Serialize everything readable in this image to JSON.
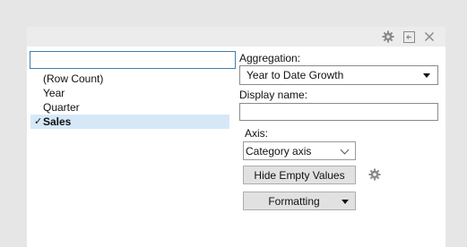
{
  "colors": {
    "selection": "#d6e8f8",
    "search_border": "#3c7fb1",
    "icon": "#8a8a8a"
  },
  "titlebar": {
    "icons": [
      "gear-icon",
      "dock-icon",
      "close-icon"
    ]
  },
  "search": {
    "value": "",
    "placeholder": ""
  },
  "columns": [
    {
      "label": "(Row Count)",
      "selected": false
    },
    {
      "label": "Year",
      "selected": false
    },
    {
      "label": "Quarter",
      "selected": false
    },
    {
      "label": "Sales",
      "selected": true
    }
  ],
  "aggregation": {
    "label": "Aggregation:",
    "value": "Year to Date Growth"
  },
  "display_name": {
    "label": "Display name:",
    "value": ""
  },
  "axis": {
    "label": "Axis:",
    "value": "Category axis"
  },
  "buttons": {
    "hide_empty": "Hide Empty Values",
    "formatting": "Formatting"
  },
  "check_glyph": "✓"
}
